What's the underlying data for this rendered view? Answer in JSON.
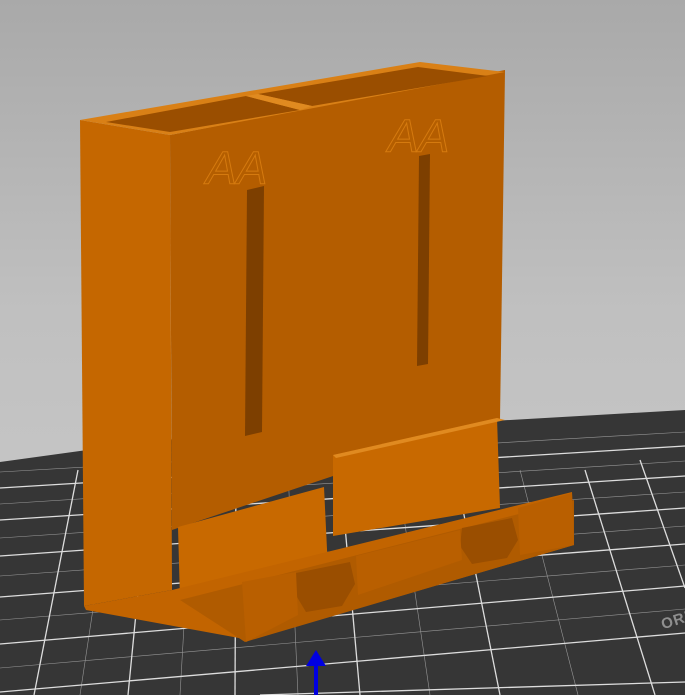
{
  "viewport": {
    "background_top": "#a9a9a9",
    "background_bottom": "#cbcbcb",
    "bed_color": "#333333",
    "grid_color": "#f2f2f2"
  },
  "model": {
    "color_face": "#bb6200",
    "color_top": "#d97c10",
    "color_dark": "#8c4a00",
    "labels": [
      "AA",
      "AA"
    ]
  },
  "bed": {
    "corner_label": "ORI"
  },
  "gizmo": {
    "axis": "z",
    "color": "#0000e0",
    "icon": "z-axis-arrow-icon"
  }
}
